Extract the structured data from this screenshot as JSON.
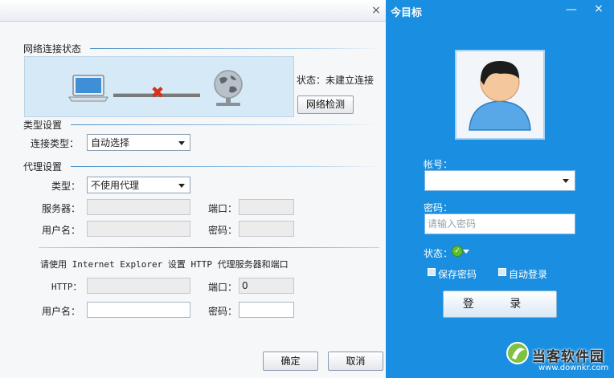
{
  "left_dialog": {
    "close_glyph": "×",
    "network_section": {
      "title": "网络连接状态",
      "status_text": "状态：未建立连接",
      "detect_button": "网络检测"
    },
    "type_section": {
      "title": "类型设置",
      "conn_type_label": "连接类型：",
      "conn_type_value": "自动选择"
    },
    "proxy_section": {
      "title": "代理设置",
      "type_label": "类型：",
      "type_value": "不使用代理",
      "server_label": "服务器：",
      "port_label": "端口：",
      "username_label": "用户名：",
      "password_label": "密码："
    },
    "ie_section": {
      "note": "请使用 Internet Explorer 设置 HTTP 代理服务器和端口",
      "http_label": "HTTP：",
      "port_label": "端口：",
      "port_value": "0",
      "username_label": "用户名：",
      "password_label": "密码："
    },
    "ok_button": "确定",
    "cancel_button": "取消"
  },
  "login_panel": {
    "title": "今目标",
    "min_glyph": "—",
    "close_glyph": "×",
    "account_label": "帐号：",
    "password_label": "密码：",
    "password_placeholder": "请输入密码",
    "status_label": "状态：",
    "remember_password": "保存密码",
    "auto_login": "自动登录",
    "login_button": "登 录"
  },
  "watermark": {
    "text": "当客软件园",
    "url": "www.downkr.com"
  },
  "colors": {
    "panel_blue": "#1a8ee0",
    "error_red": "#d8301a",
    "online_green": "#5fbf2a"
  }
}
